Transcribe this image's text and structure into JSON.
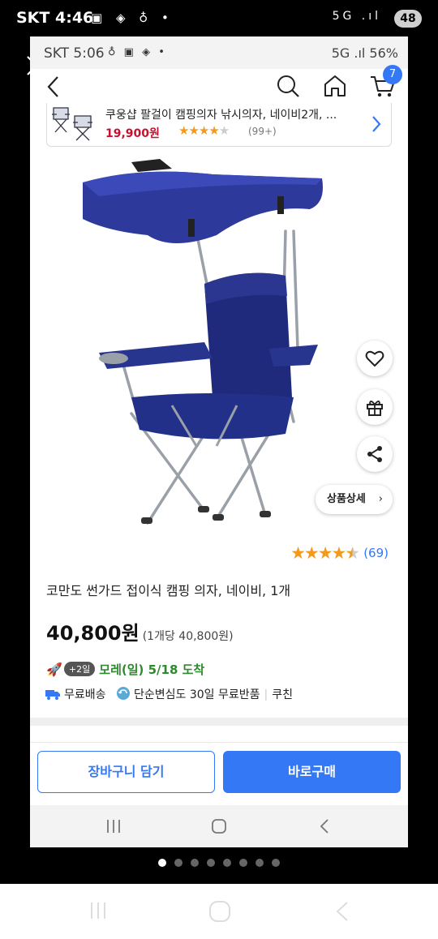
{
  "outer_status": {
    "carrier": "SKT",
    "time": "4:46",
    "net_icons": "5G .ıl",
    "battery": "48"
  },
  "inner_status": {
    "carrier_time": "SKT 5:06",
    "right": "5G .ıl 56%"
  },
  "header": {
    "cart_count": "7"
  },
  "related_product": {
    "title": "쿠웅샵 팔걸이 캠핑의자 낚시의자, 네이비2개, ...",
    "price": "19,900원",
    "rating_count": "(99+)"
  },
  "actions": {
    "detail_label": "상품상세"
  },
  "product": {
    "review_count": "(69)",
    "title": "코만도 썬가드 접이식 캠핑 의자, 네이비, 1개",
    "price": "40,800원",
    "unit_price": "(1개당 40,800원)",
    "delivery_badge": "+2일",
    "delivery_date": "모레(일) 5/18 도착",
    "free_shipping": "무료배송",
    "return_policy": "단순변심도 30일 무료반품",
    "seller": "쿠친"
  },
  "buttons": {
    "add_cart": "장바구니 담기",
    "buy_now": "바로구매"
  },
  "colors": {
    "accent": "#3478f6",
    "price_red": "#c8102e",
    "star": "#f39a1d",
    "delivery_green": "#2d8a2d"
  },
  "rating": {
    "product_stars": 4.5,
    "related_stars": 4
  },
  "carousel": {
    "pages": 8,
    "current": 1
  },
  "icons": [
    "close-icon",
    "back-icon",
    "search-icon",
    "home-icon",
    "cart-icon",
    "chevron-right-icon",
    "heart-icon",
    "gift-icon",
    "share-icon",
    "rocket-icon",
    "truck-icon",
    "return-icon"
  ]
}
